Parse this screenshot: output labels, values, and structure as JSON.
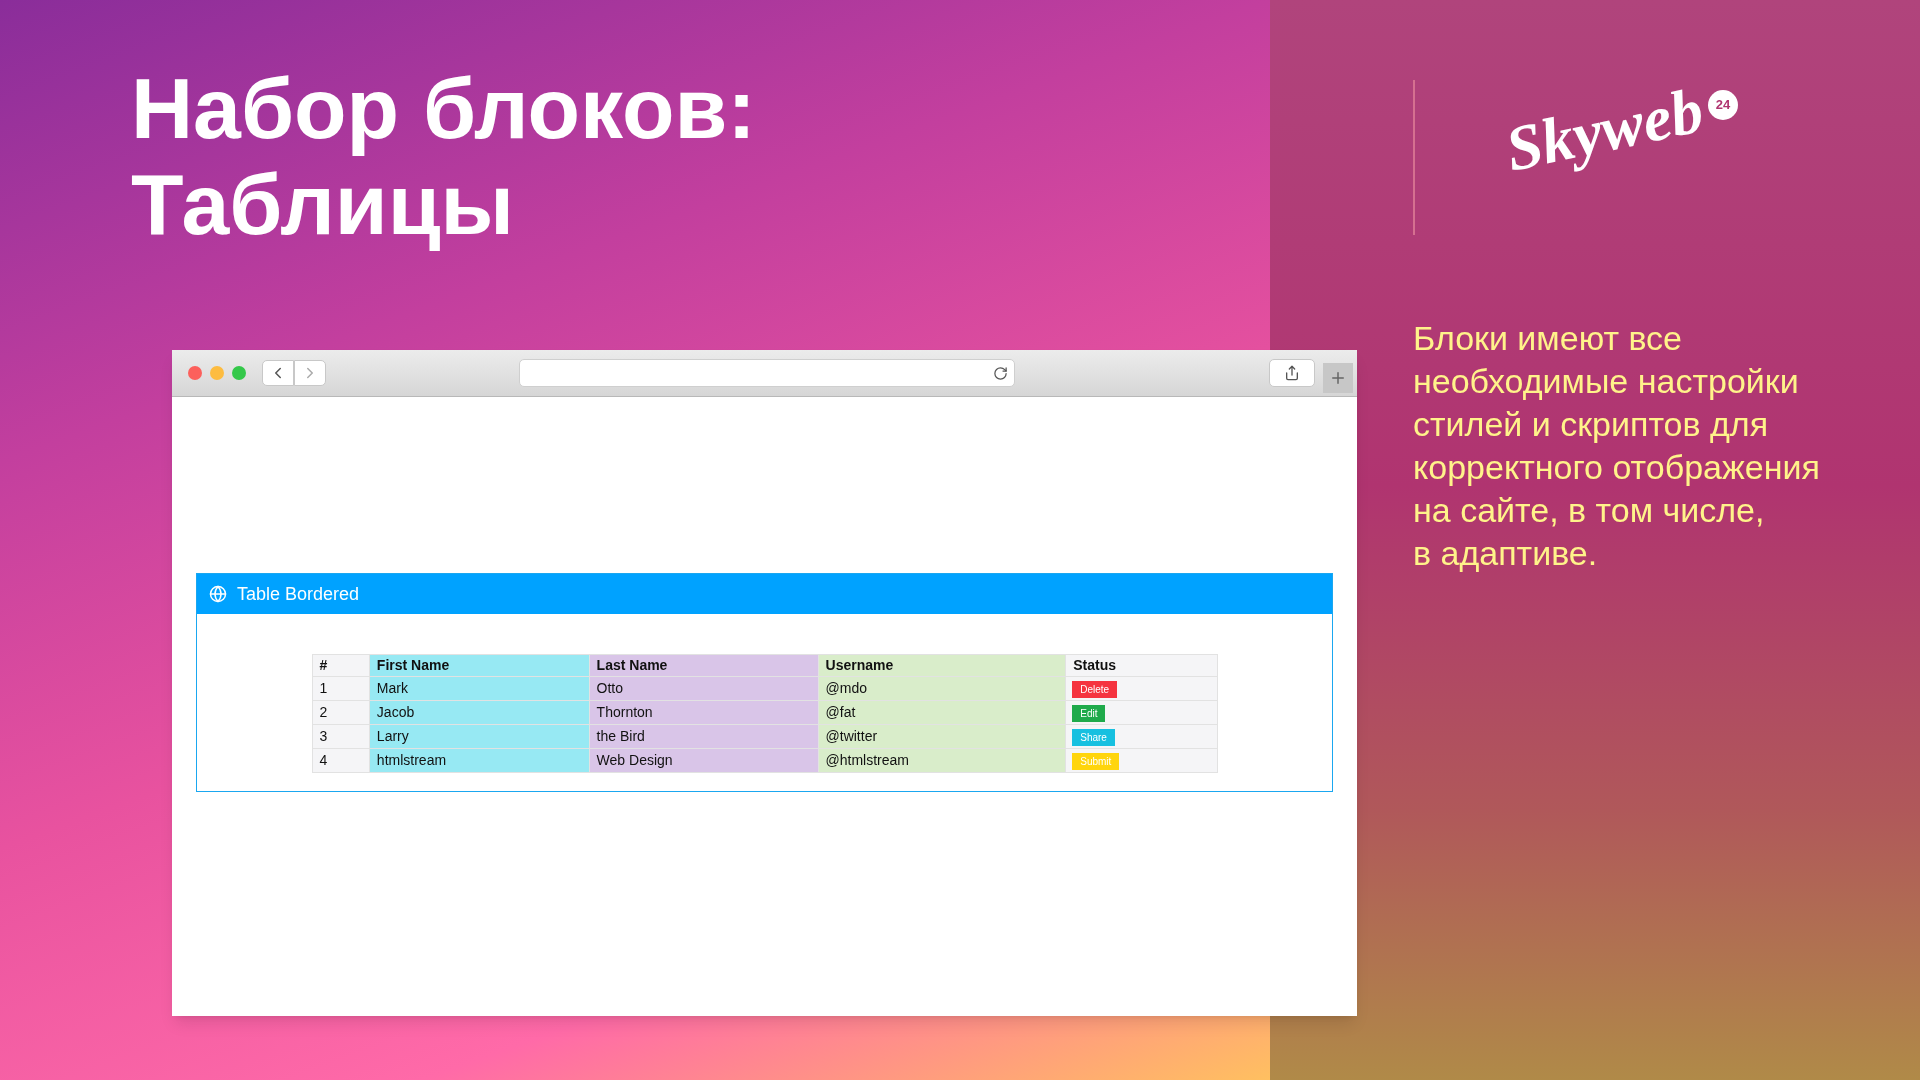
{
  "heading": {
    "lines": [
      "Набор блоков:",
      "Таблицы"
    ]
  },
  "logo": {
    "wordmark": "Skyweb",
    "badge": "24"
  },
  "description": {
    "lines": [
      "Блоки имеют все",
      "необходимые настройки",
      "стилей и скриптов для",
      "корректного отображения",
      "на сайте, в том числе,",
      "в адаптиве."
    ]
  },
  "browser": {
    "panel": {
      "title": "Table Bordered"
    },
    "table": {
      "columns": [
        {
          "label": "#",
          "color": "#f5f5f7"
        },
        {
          "label": "First Name",
          "color": "#97e9f3"
        },
        {
          "label": "Last Name",
          "color": "#d9c5e8"
        },
        {
          "label": "Username",
          "color": "#d9edca"
        },
        {
          "label": "Status",
          "color": "#f5f5f7"
        }
      ],
      "rows": [
        {
          "cells": [
            "1",
            "Mark",
            "Otto",
            "@mdo"
          ],
          "status": {
            "label": "Delete",
            "color": "#f5333f"
          }
        },
        {
          "cells": [
            "2",
            "Jacob",
            "Thornton",
            "@fat"
          ],
          "status": {
            "label": "Edit",
            "color": "#1faa4b"
          }
        },
        {
          "cells": [
            "3",
            "Larry",
            "the Bird",
            "@twitter"
          ],
          "status": {
            "label": "Share",
            "color": "#17c0e0"
          }
        },
        {
          "cells": [
            "4",
            "htmlstream",
            "Web Design",
            "@htmlstream"
          ],
          "status": {
            "label": "Submit",
            "color": "#ffd50c"
          }
        }
      ]
    }
  }
}
